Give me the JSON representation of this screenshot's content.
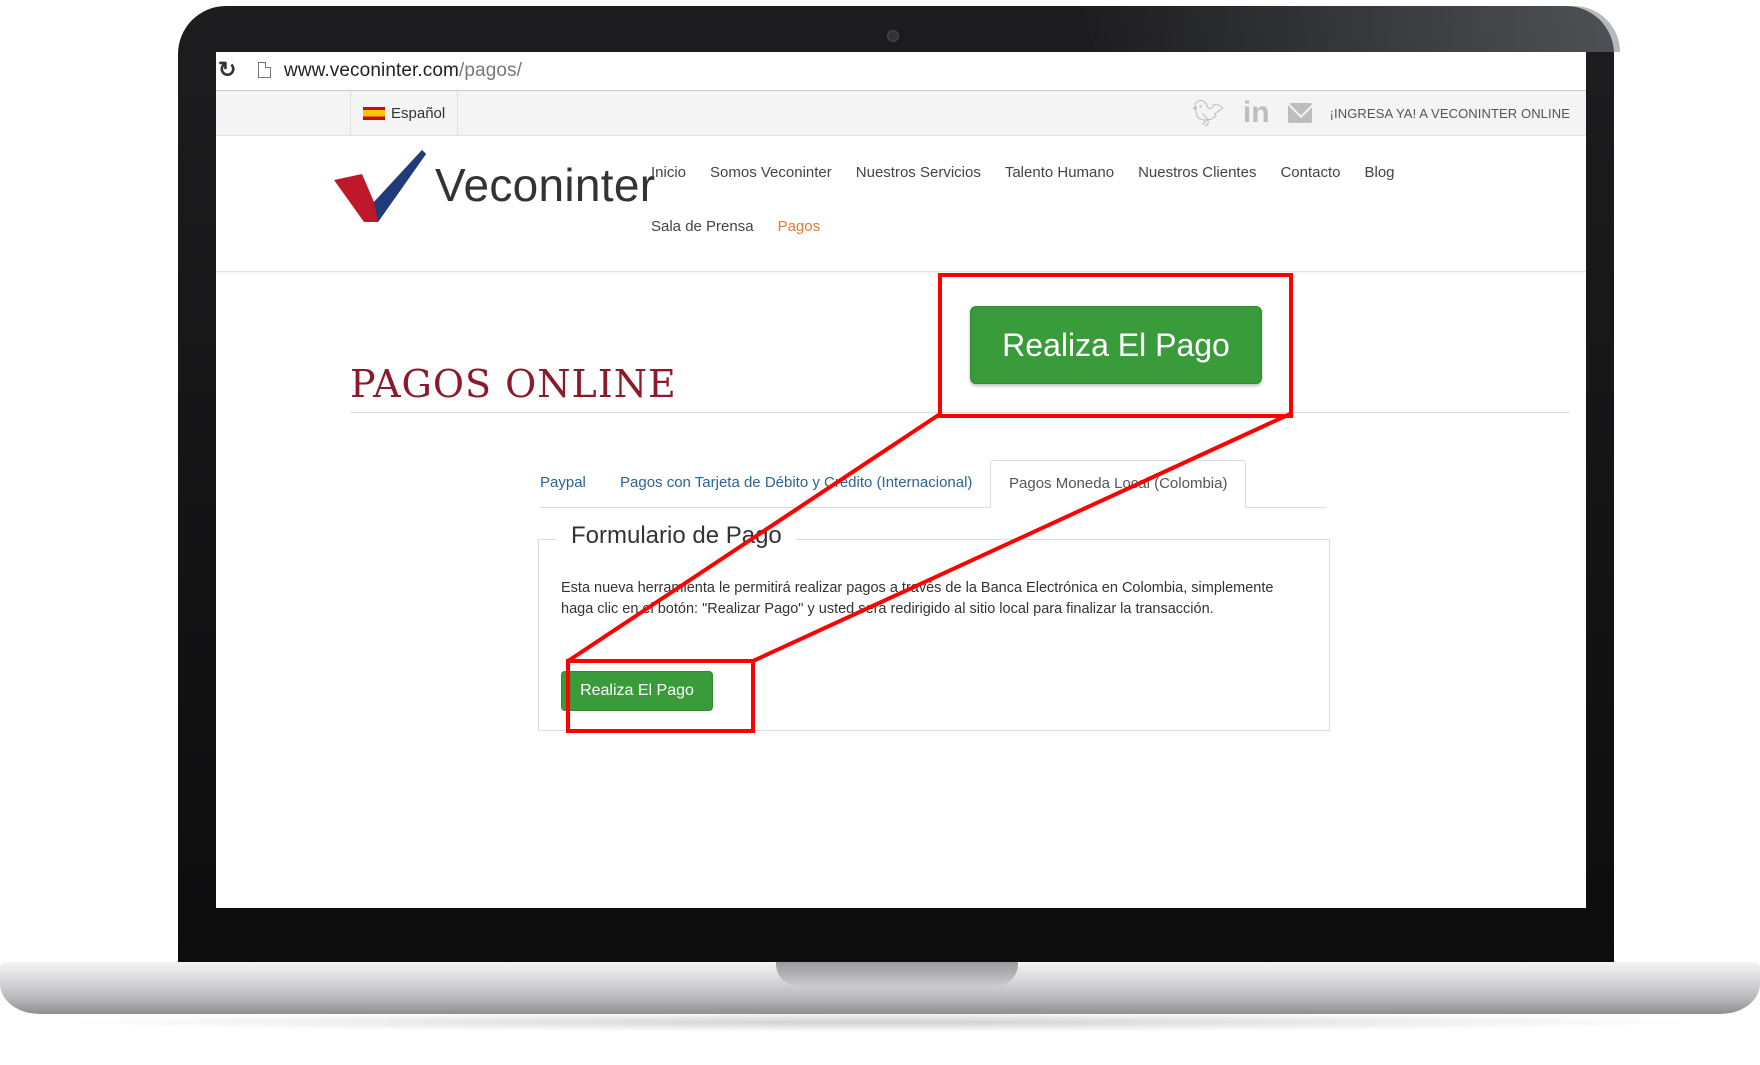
{
  "browser": {
    "url_host": "www.veconinter.com",
    "url_path": "/pagos/"
  },
  "topbar": {
    "language": "Español",
    "cta": "¡INGRESA YA! A VECONINTER ONLINE",
    "social_icons": [
      "twitter-icon",
      "linkedin-icon",
      "mail-icon"
    ]
  },
  "header": {
    "logo_text": "Veconinter",
    "nav_row1": [
      "Inicio",
      "Somos Veconinter",
      "Nuestros Servicios",
      "Talento Humano",
      "Nuestros Clientes",
      "Contacto",
      "Blog"
    ],
    "nav_row2": [
      "Sala de Prensa",
      "Pagos"
    ],
    "active_item": "Pagos"
  },
  "main": {
    "title": "PAGOS ONLINE",
    "tabs": [
      {
        "label": "Paypal"
      },
      {
        "label": "Pagos con Tarjeta de Débito y Crédito (Internacional)"
      },
      {
        "label": "Pagos Moneda Local (Colombia)",
        "active": true
      }
    ],
    "form": {
      "legend": "Formulario de Pago",
      "description": "Esta nueva herramienta le permitirá realizar pagos a través de la Banca Electrónica en Colombia, simplemente haga clic en el botón: \"Realizar Pago\" y usted será redirigido al sitio local para finalizar la transacción.",
      "button_label": "Realiza El Pago"
    }
  },
  "annotation": {
    "zoom_button_label": "Realiza El Pago",
    "highlight_color": "#ff0000"
  },
  "colors": {
    "brand_red": "#8b1a2b",
    "button_green": "#3a9b3a",
    "active_nav": "#e07b39",
    "tab_link": "#2a6496"
  }
}
